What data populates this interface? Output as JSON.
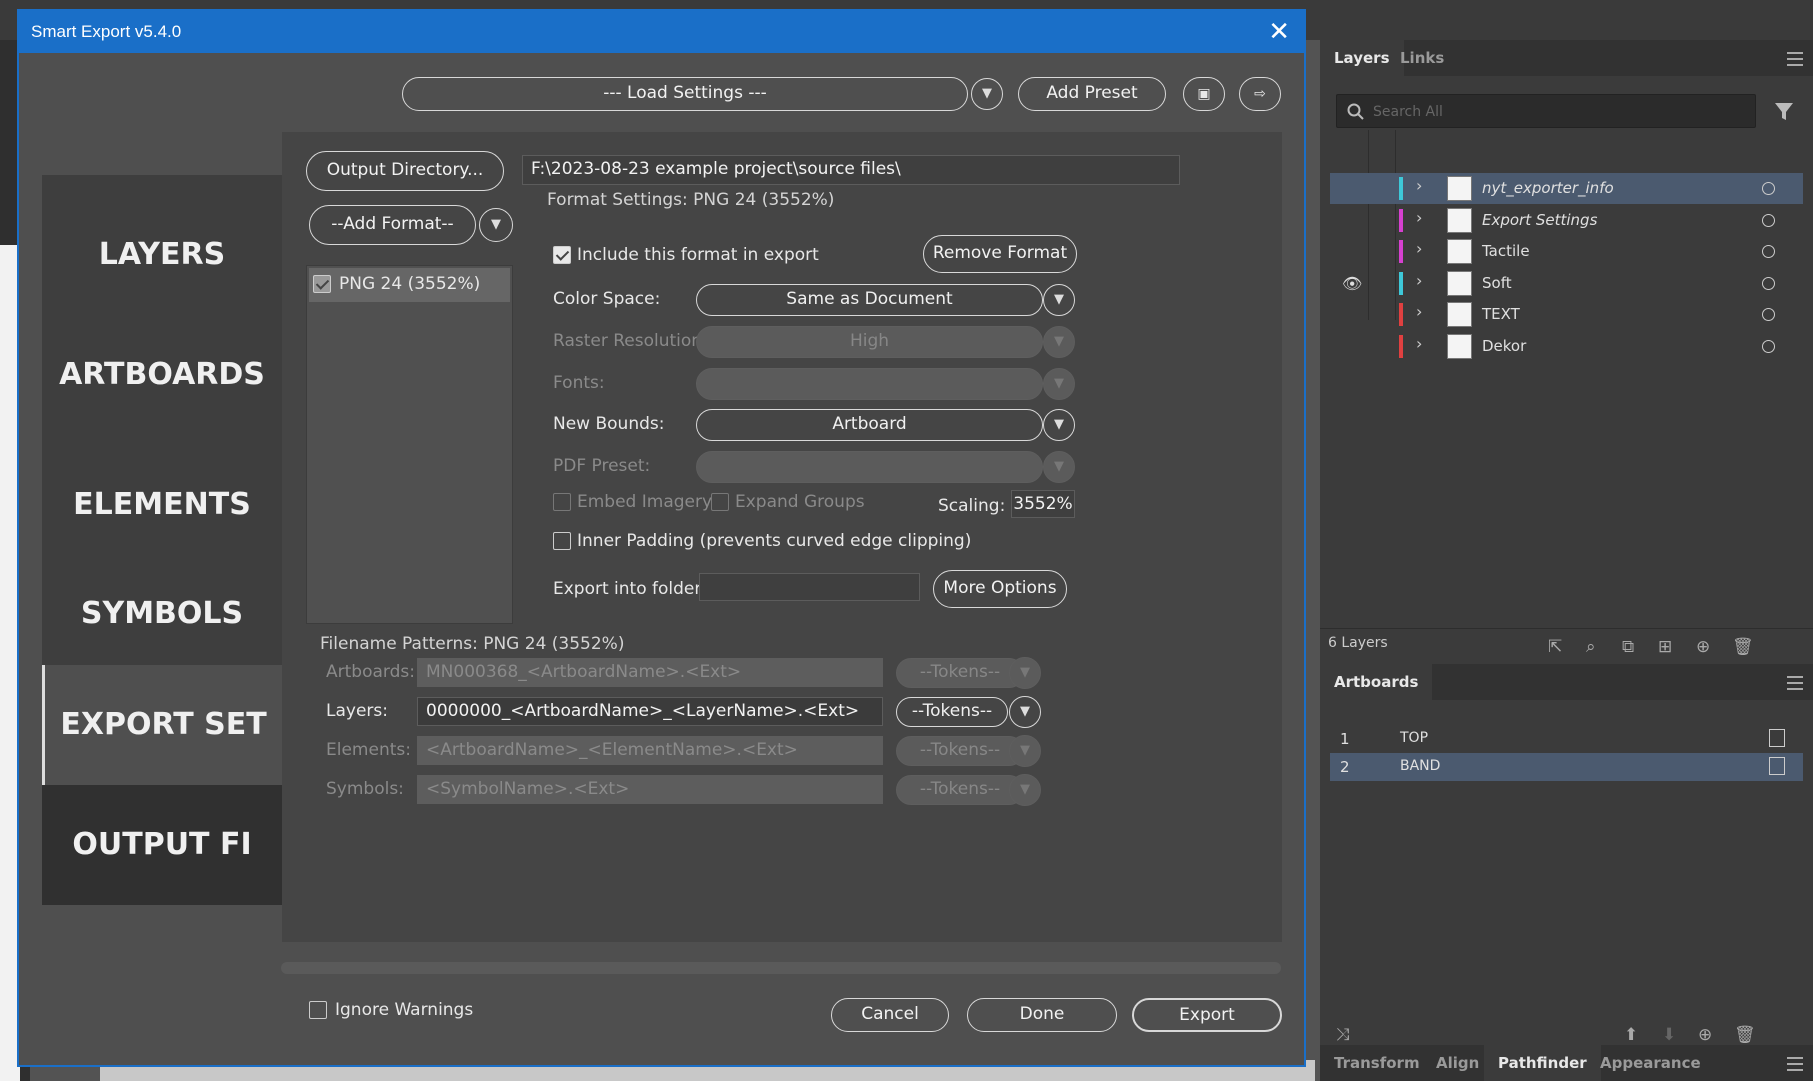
{
  "dialog": {
    "title": "Smart Export v5.4.0",
    "load_settings": "--- Load Settings ---",
    "add_preset": "Add Preset",
    "output_directory_btn": "Output Directory...",
    "output_path": "F:\\2023-08-23 example project\\source files\\",
    "add_format": "--Add Format--",
    "format_item": "PNG 24 (3552%)",
    "format_settings_title": "Format Settings: PNG 24 (3552%)",
    "include_label": "Include this format in export",
    "remove_format": "Remove Format",
    "color_space_label": "Color Space:",
    "color_space_value": "Same as Document",
    "raster_label": "Raster Resolution",
    "raster_value": "High",
    "fonts_label": "Fonts:",
    "new_bounds_label": "New Bounds:",
    "new_bounds_value": "Artboard",
    "pdf_preset_label": "PDF Preset:",
    "embed_imagery": "Embed Imagery",
    "expand_groups": "Expand Groups",
    "scaling_label": "Scaling:",
    "scaling_value": "3552%",
    "inner_padding": "Inner Padding (prevents curved edge clipping)",
    "export_folder_label": "Export into folder:",
    "export_folder_value": "",
    "more_options": "More Options",
    "filename_patterns_title": "Filename Patterns: PNG 24 (3552%)",
    "patterns": {
      "artboards_label": "Artboards:",
      "artboards_value": "MN000368_<ArtboardName>.<Ext>",
      "layers_label": "Layers:",
      "layers_value": "0000000_<ArtboardName>_<LayerName>.<Ext>",
      "elements_label": "Elements:",
      "elements_value": "<ArtboardName>_<ElementName>.<Ext>",
      "symbols_label": "Symbols:",
      "symbols_value": "<SymbolName>.<Ext>",
      "tokens": "--Tokens--"
    },
    "ignore_warnings": "Ignore Warnings",
    "cancel": "Cancel",
    "done": "Done",
    "export": "Export",
    "nav": [
      "LAYERS",
      "ARTBOARDS",
      "ELEMENTS",
      "SYMBOLS",
      "EXPORT SET",
      "OUTPUT FI"
    ]
  },
  "layers_panel": {
    "tabs": [
      "Layers",
      "Links"
    ],
    "search_placeholder": "Search All",
    "layers": [
      {
        "name": "nyt_exporter_info",
        "color": "#3ec8d8",
        "italic": true,
        "selected": true
      },
      {
        "name": "Export Settings",
        "color": "#d640d0",
        "italic": true
      },
      {
        "name": "Tactile",
        "color": "#d640d0"
      },
      {
        "name": "Soft",
        "color": "#3ec8d8",
        "visible": true
      },
      {
        "name": "TEXT",
        "color": "#e04040"
      },
      {
        "name": "Dekor",
        "color": "#e04040"
      }
    ],
    "count": "6 Layers"
  },
  "artboards_panel": {
    "title": "Artboards",
    "items": [
      {
        "num": "1",
        "name": "TOP"
      },
      {
        "num": "2",
        "name": "BAND"
      }
    ]
  },
  "bottom_tabs": [
    "Transform",
    "Align",
    "Pathfinder",
    "Appearance"
  ],
  "colors": {
    "accent": "#1a6fc8",
    "selection": "#4b5a6f"
  }
}
